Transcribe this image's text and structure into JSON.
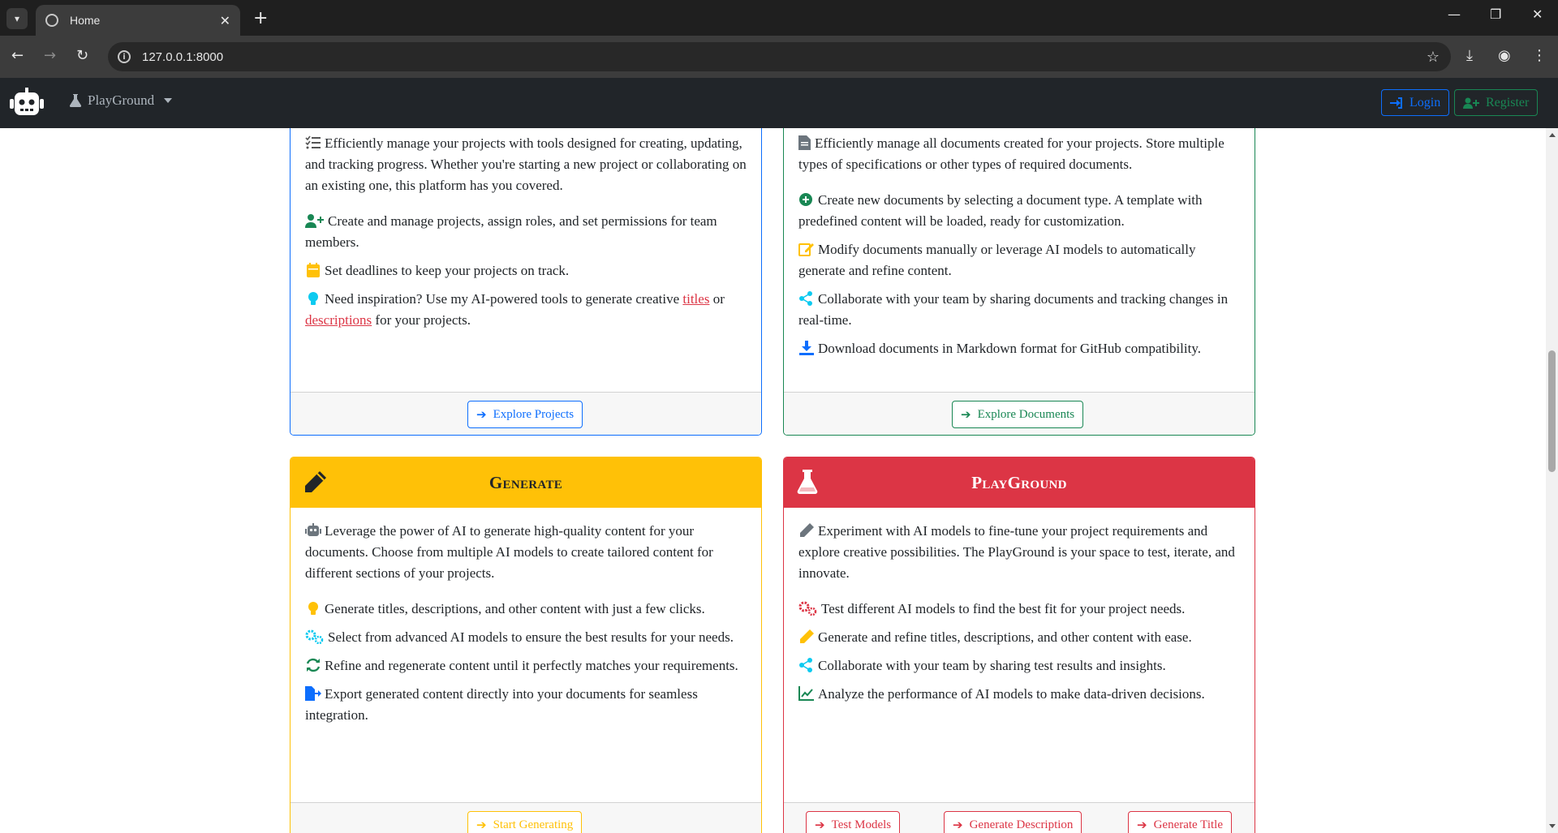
{
  "browser": {
    "tab_title": "Home",
    "url": "127.0.0.1:8000"
  },
  "navbar": {
    "brand_label": "PlayGround",
    "login_label": "Login",
    "register_label": "Register"
  },
  "cards": {
    "projects": {
      "intro": "Efficiently manage your projects with tools designed for creating, updating, and tracking progress. Whether you're starting a new project or collaborating on an existing one, this platform has you covered.",
      "item1": "Create and manage projects, assign roles, and set permissions for team members.",
      "item2": "Set deadlines to keep your projects on track.",
      "item3_pre": "Need inspiration? Use my AI-powered tools to generate creative",
      "item3_link1": "titles",
      "item3_mid": "or",
      "item3_link2": "descriptions",
      "item3_post": "for your projects.",
      "button": "Explore Projects",
      "accent": "#0d6efd"
    },
    "documents": {
      "intro": "Efficiently manage all documents created for your projects. Store multiple types of specifications or other types of required documents.",
      "item1": "Create new documents by selecting a document type. A template with predefined content will be loaded, ready for customization.",
      "item2": "Modify documents manually or leverage AI models to automatically generate and refine content.",
      "item3": "Collaborate with your team by sharing documents and tracking changes in real-time.",
      "item4": "Download documents in Markdown format for GitHub compatibility.",
      "button": "Explore Documents",
      "accent": "#198754"
    },
    "generate": {
      "title": "Generate",
      "intro": "Leverage the power of AI to generate high-quality content for your documents. Choose from multiple AI models to create tailored content for different sections of your projects.",
      "item1": "Generate titles, descriptions, and other content with just a few clicks.",
      "item2": "Select from advanced AI models to ensure the best results for your needs.",
      "item3": "Refine and regenerate content until it perfectly matches your requirements.",
      "item4": "Export generated content directly into your documents for seamless integration.",
      "button": "Start Generating",
      "accent": "#ffc107"
    },
    "playground": {
      "title": "PlayGround",
      "intro": "Experiment with AI models to fine-tune your project requirements and explore creative possibilities. The PlayGround is your space to test, iterate, and innovate.",
      "item1": "Test different AI models to find the best fit for your project needs.",
      "item2": "Generate and refine titles, descriptions, and other content with ease.",
      "item3": "Collaborate with your team by sharing test results and insights.",
      "item4": "Analyze the performance of AI models to make data-driven decisions.",
      "button1": "Test Models",
      "button2": "Generate Description",
      "button3": "Generate Title",
      "accent": "#dc3545"
    }
  }
}
